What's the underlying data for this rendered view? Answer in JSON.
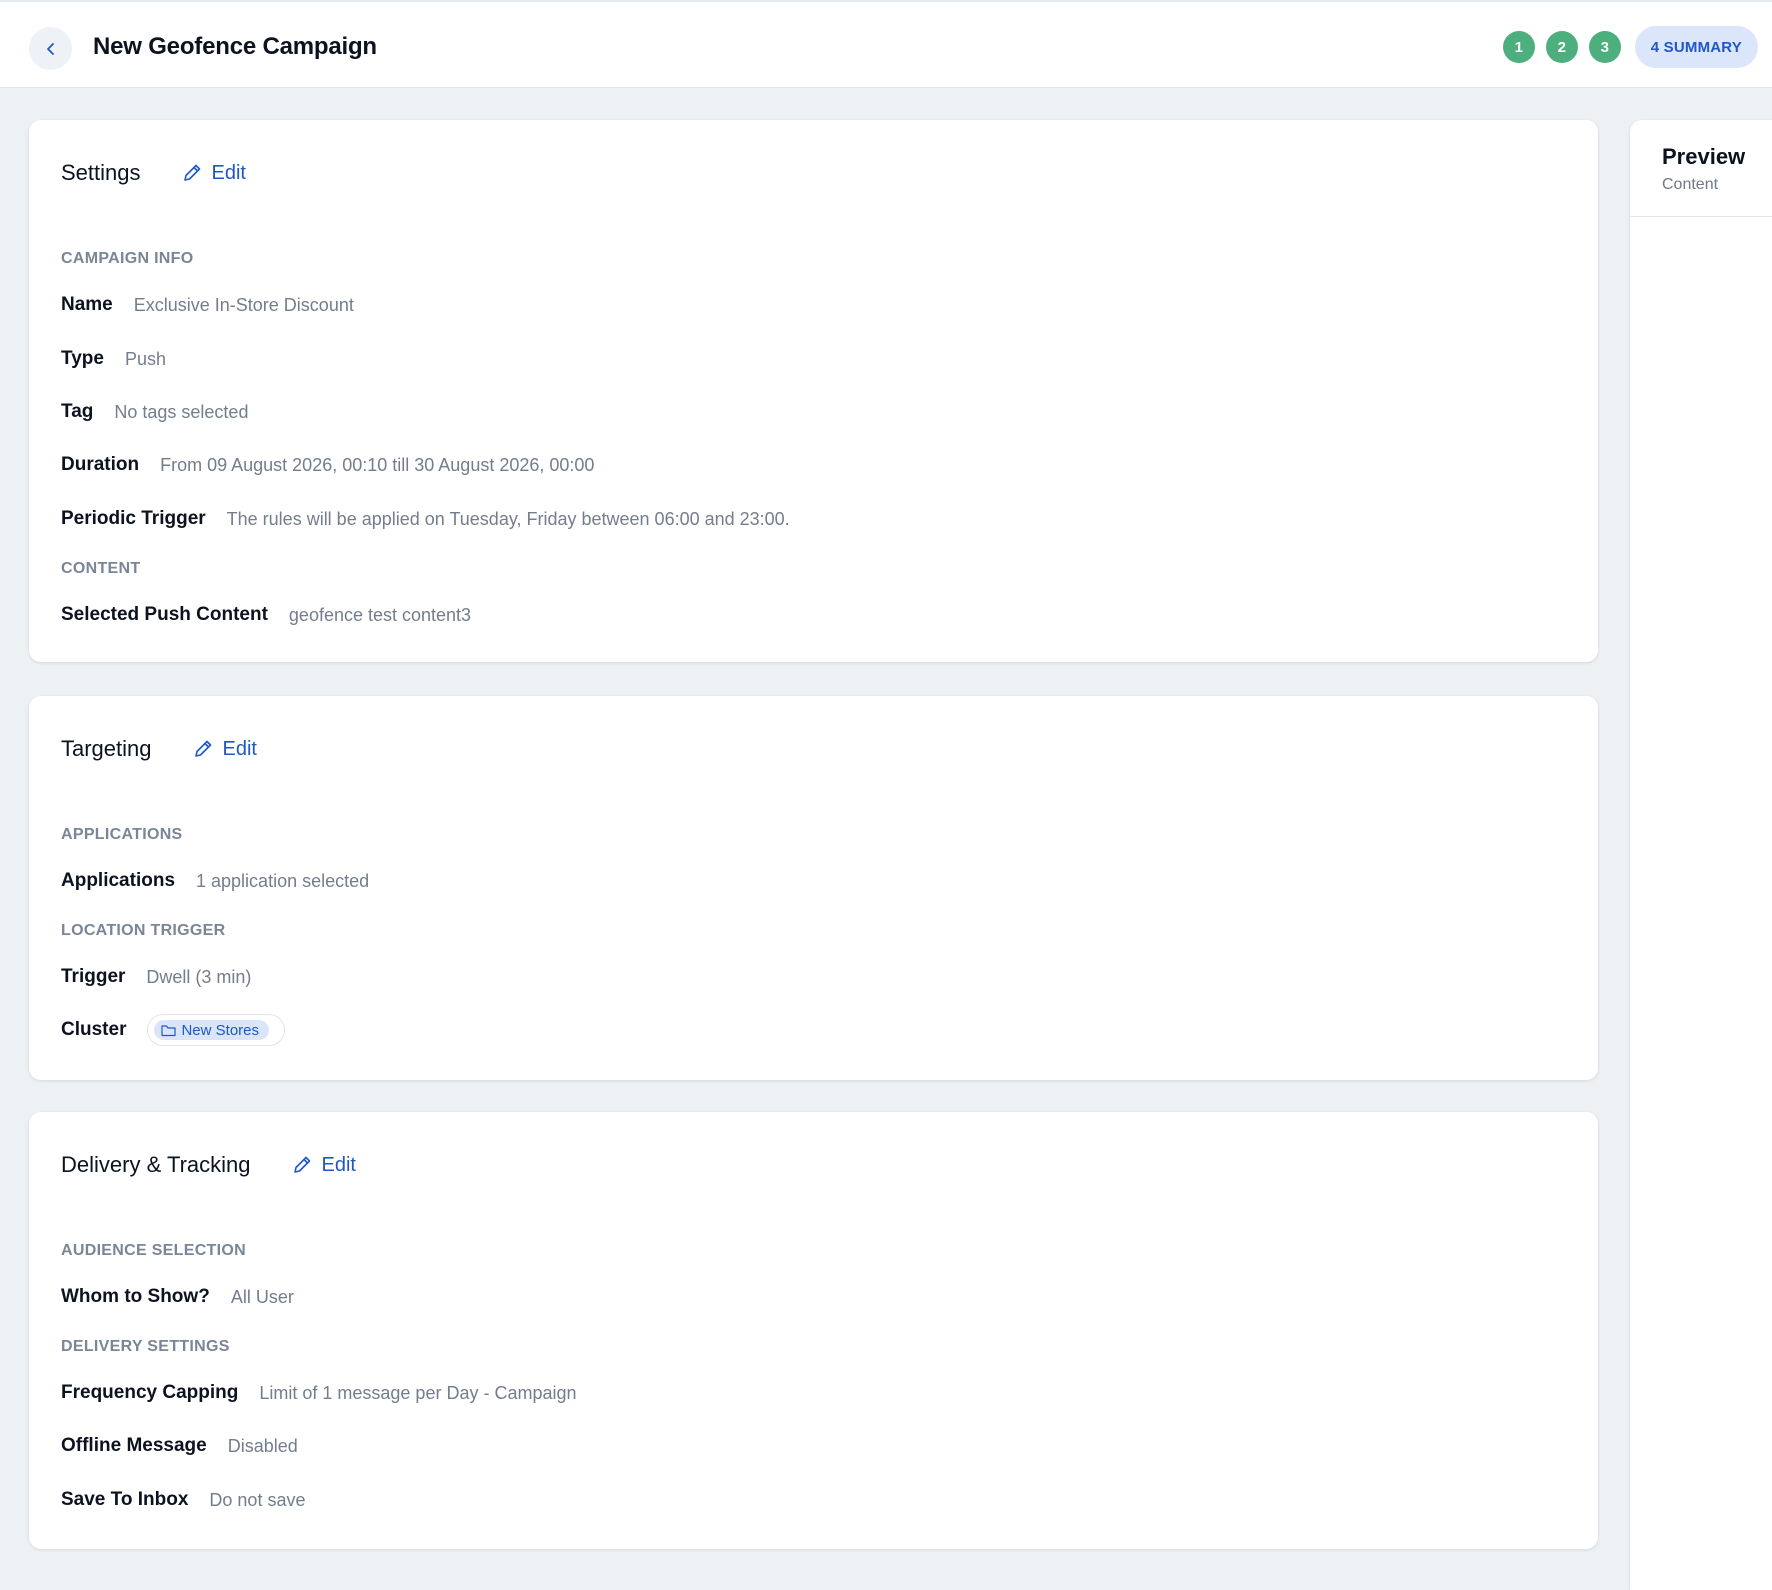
{
  "header": {
    "title": "New Geofence Campaign",
    "steps": [
      "1",
      "2",
      "3"
    ],
    "current_step": "4 SUMMARY"
  },
  "settings": {
    "title": "Settings",
    "edit_label": "Edit",
    "campaign_info_label": "CAMPAIGN INFO",
    "content_label": "CONTENT",
    "rows": [
      {
        "key": "Name",
        "value": "Exclusive In-Store Discount"
      },
      {
        "key": "Type",
        "value": "Push"
      },
      {
        "key": "Tag",
        "value": "No tags selected"
      },
      {
        "key": "Duration",
        "value": "From 09 August 2026, 00:10 till 30 August 2026, 00:00"
      },
      {
        "key": "Periodic Trigger",
        "value": "The rules will be applied on Tuesday, Friday between 06:00 and 23:00."
      },
      {
        "key": "Selected Push Content",
        "value": "geofence test content3"
      }
    ]
  },
  "targeting": {
    "title": "Targeting",
    "edit_label": "Edit",
    "applications_label": "APPLICATIONS",
    "location_trigger_label": "LOCATION TRIGGER",
    "rows": [
      {
        "key": "Applications",
        "value": "1 application selected"
      },
      {
        "key": "Trigger",
        "value": "Dwell (3 min)"
      },
      {
        "key": "Cluster",
        "value": "New Stores"
      }
    ]
  },
  "delivery": {
    "title": "Delivery & Tracking",
    "edit_label": "Edit",
    "audience_label": "AUDIENCE SELECTION",
    "delivery_settings_label": "DELIVERY SETTINGS",
    "rows": [
      {
        "key": "Whom to Show?",
        "value": "All User"
      },
      {
        "key": "Frequency Capping",
        "value": "Limit of 1 message per Day - Campaign"
      },
      {
        "key": "Offline Message",
        "value": "Disabled"
      },
      {
        "key": "Save To Inbox",
        "value": "Do not save"
      }
    ]
  },
  "preview": {
    "title": "Preview",
    "subtitle": "Content"
  },
  "icons": {
    "back": "chevron-left-icon",
    "edit": "pencil-icon",
    "cluster": "folder-icon"
  },
  "colors": {
    "accent": "#1e57c8",
    "step_done": "#4caf7d",
    "step_current_bg": "#dce6fa",
    "muted": "#737d8c"
  }
}
